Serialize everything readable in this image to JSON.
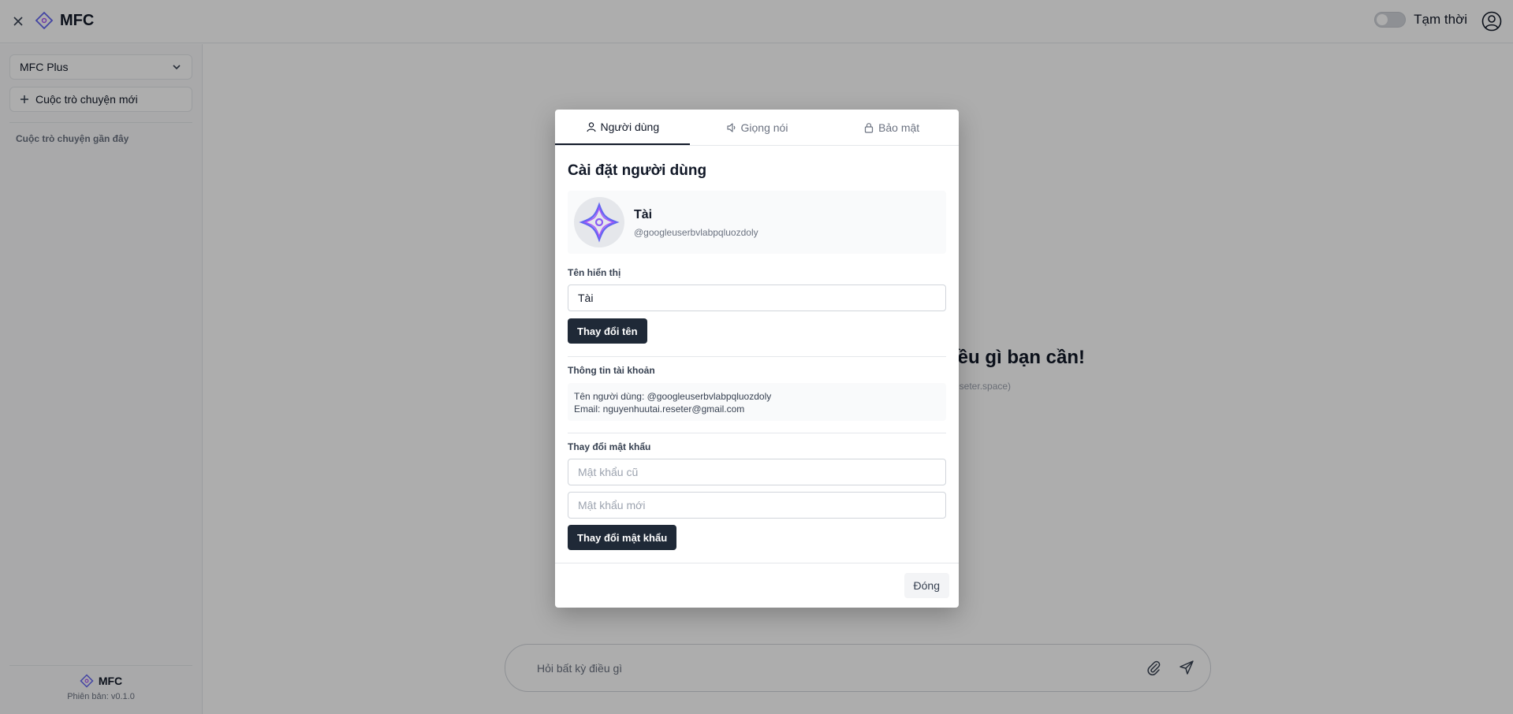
{
  "app": {
    "name": "MFC",
    "accent": "#6366f1"
  },
  "header": {
    "temporary_label": "Tạm thời"
  },
  "sidebar": {
    "model": "MFC Plus",
    "new_chat": "Cuộc trò chuyện mới",
    "recent_label": "Cuộc trò chuyện gần đây",
    "footer_brand": "MFC",
    "version": "Phiên bản: v0.1.0"
  },
  "main": {
    "hero_visible": "iều gì bạn cần!",
    "hero_sub_visible": "eseter.space)",
    "prompt_placeholder": "Hỏi bất kỳ điều gì"
  },
  "modal": {
    "tabs": [
      {
        "label": "Người dùng",
        "icon": "user-icon",
        "active": true
      },
      {
        "label": "Giọng nói",
        "icon": "speaker-icon",
        "active": false
      },
      {
        "label": "Bảo mật",
        "icon": "lock-icon",
        "active": false
      }
    ],
    "title": "Cài đặt người dùng",
    "profile": {
      "name": "Tài",
      "handle": "@googleuserbvlabpqluozdoly"
    },
    "display_name_label": "Tên hiển thị",
    "display_name_value": "Tài",
    "change_name_button": "Thay đổi tên",
    "account_info_label": "Thông tin tài khoản",
    "account_username": "Tên người dùng: @googleuserbvlabpqluozdoly",
    "account_email": "Email: nguyenhuutai.reseter@gmail.com",
    "change_password_label": "Thay đổi mật khẩu",
    "old_password_placeholder": "Mật khẩu cũ",
    "new_password_placeholder": "Mật khẩu mới",
    "change_password_button": "Thay đổi mật khẩu",
    "close_button": "Đóng"
  }
}
